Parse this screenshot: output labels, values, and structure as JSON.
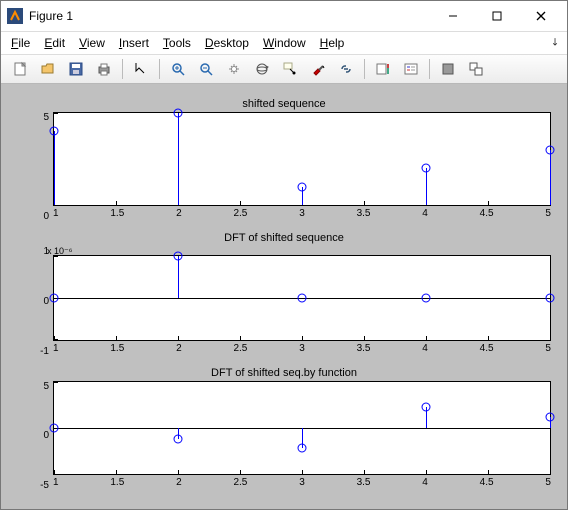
{
  "window": {
    "title": "Figure 1"
  },
  "menu": {
    "file": "File",
    "edit": "Edit",
    "view": "View",
    "insert": "Insert",
    "tools": "Tools",
    "desktop": "Desktop",
    "window": "Window",
    "help": "Help"
  },
  "chart_data": [
    {
      "type": "stem",
      "title": "shifted sequence",
      "x": [
        1,
        2,
        3,
        4,
        5
      ],
      "values": [
        4,
        5,
        1,
        2,
        3
      ],
      "xlim": [
        1,
        5
      ],
      "ylim": [
        0,
        5
      ],
      "yticks": [
        0,
        5
      ],
      "xticks": [
        1,
        1.5,
        2,
        2.5,
        3,
        3.5,
        4,
        4.5,
        5
      ],
      "baseline": 0
    },
    {
      "type": "stem",
      "title": "DFT of shifted sequence",
      "y_exponent": "x 10⁻⁶",
      "x": [
        1,
        2,
        3,
        4,
        5
      ],
      "values": [
        0,
        1,
        0,
        0,
        0
      ],
      "xlim": [
        1,
        5
      ],
      "ylim": [
        -1,
        1
      ],
      "yticks": [
        -1,
        0,
        1
      ],
      "xticks": [
        1,
        1.5,
        2,
        2.5,
        3,
        3.5,
        4,
        4.5,
        5
      ],
      "baseline": 0
    },
    {
      "type": "stem",
      "title": "DFT of shifted seq.by function",
      "x": [
        1,
        2,
        3,
        4,
        5
      ],
      "values": [
        0,
        -1.2,
        -2.2,
        2.2,
        1.2
      ],
      "xlim": [
        1,
        5
      ],
      "ylim": [
        -5,
        5
      ],
      "yticks": [
        -5,
        0,
        5
      ],
      "xticks": [
        1,
        1.5,
        2,
        2.5,
        3,
        3.5,
        4,
        4.5,
        5
      ],
      "baseline": 0
    }
  ]
}
